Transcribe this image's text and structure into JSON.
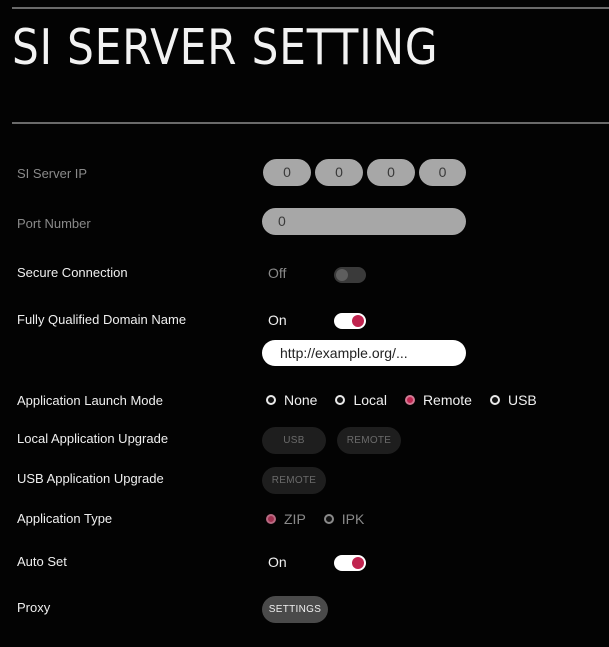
{
  "page": {
    "title": "SI SERVER SETTING"
  },
  "si_server_ip": {
    "label": "SI Server IP",
    "octets": [
      "0",
      "0",
      "0",
      "0"
    ]
  },
  "port_number": {
    "label": "Port Number",
    "value": "0"
  },
  "secure_connection": {
    "label": "Secure Connection",
    "state": "Off"
  },
  "fqdn": {
    "label": "Fully Qualified Domain Name",
    "state": "On",
    "url": "http://example.org/..."
  },
  "launch_mode": {
    "label": "Application Launch Mode",
    "options": [
      "None",
      "Local",
      "Remote",
      "USB"
    ],
    "selected": "Remote"
  },
  "local_upgrade": {
    "label": "Local Application Upgrade",
    "usb_label": "USB",
    "remote_label": "REMOTE"
  },
  "usb_upgrade": {
    "label": "USB Application Upgrade",
    "remote_label": "REMOTE"
  },
  "app_type": {
    "label": "Application Type",
    "options": [
      "ZIP",
      "IPK"
    ],
    "selected": "ZIP"
  },
  "auto_set": {
    "label": "Auto Set",
    "state": "On"
  },
  "proxy": {
    "label": "Proxy",
    "settings_label": "SETTINGS"
  },
  "colors": {
    "accent": "#c0244f",
    "background": "#030303",
    "field": "#a7a7a7"
  }
}
